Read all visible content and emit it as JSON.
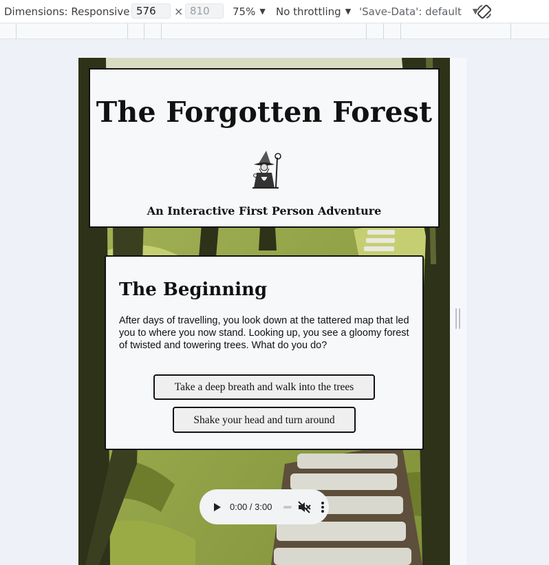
{
  "devtools": {
    "dimensions_label": "Dimensions: Responsive",
    "width_value": "576",
    "height_placeholder": "810",
    "times_sign": "×",
    "zoom_label": "75%",
    "throttling_label": "No throttling",
    "save_data_label": "'Save-Data': default"
  },
  "page": {
    "title": "The Forgotten Forest",
    "subtitle": "An Interactive First Person Adventure",
    "story": {
      "heading": "The Beginning",
      "text": "After days of travelling, you look down at the tattered map that led you to where you now stand. Looking up, you see a gloomy forest of twisted and towering trees. What do you do?",
      "choices": [
        "Take a deep breath and walk into the trees",
        "Shake your head and turn around"
      ]
    },
    "audio": {
      "time": "0:00 / 3:00"
    }
  },
  "icons": {
    "caret": "chevron-down-icon",
    "rotate": "rotate-icon",
    "wizard": "wizard-icon",
    "play": "play-icon",
    "mute": "volume-muted-icon",
    "more": "more-vertical-icon"
  },
  "colors": {
    "card_bg": "#f7f8fa",
    "border": "#111111",
    "forest_green": "#8fa044",
    "tree_dark": "#2d3219"
  }
}
